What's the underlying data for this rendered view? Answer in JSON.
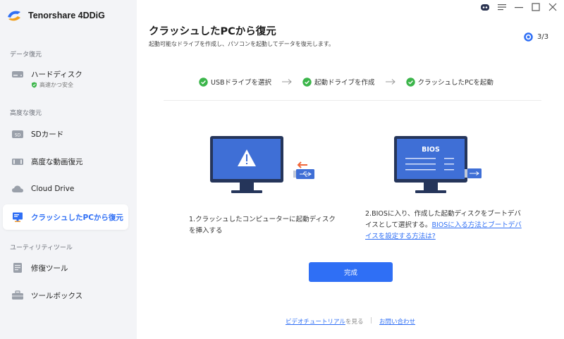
{
  "app": {
    "name": "Tenorshare 4DDiG"
  },
  "sidebar": {
    "sections": [
      {
        "label": "データ復元"
      },
      {
        "label": "高度な復元"
      },
      {
        "label": "ユーティリティツール"
      }
    ],
    "items": [
      {
        "label": "ハードディスク",
        "badge": "高速かつ安全",
        "icon": "hard-disk-icon"
      },
      {
        "label": "SDカード",
        "icon": "sd-card-icon"
      },
      {
        "label": "高度な動画復元",
        "icon": "video-icon"
      },
      {
        "label": "Cloud Drive",
        "icon": "cloud-icon"
      },
      {
        "label": "クラッシュしたPCから復元",
        "icon": "crashed-pc-icon",
        "active": true
      },
      {
        "label": "修復ツール",
        "icon": "repair-icon"
      },
      {
        "label": "ツールボックス",
        "icon": "toolbox-icon"
      }
    ]
  },
  "page": {
    "title": "クラッシュしたPCから復元",
    "subtitle": "起動可能なドライブを作成し、パソコンを起動してデータを復元します。",
    "step_count": "3/3"
  },
  "steps": [
    {
      "label": "USBドライブを選択"
    },
    {
      "label": "起動ドライブを作成"
    },
    {
      "label": "クラッシュしたPCを起動"
    }
  ],
  "illustration_left": {
    "caption": "1.クラッシュしたコンピューターに起動ディスクを挿入する"
  },
  "illustration_right": {
    "screen_label": "BIOS",
    "caption_prefix": "2.BIOSに入り、作成した起動ディスクをブートデバイスとして選択する。",
    "caption_link": "BIOSに入る方法とブートデバイスを設定する方法は?"
  },
  "done_label": "完成",
  "footer": {
    "video_link": "ビデオチュートリアル",
    "video_suffix": "を見る",
    "separator": "|",
    "contact_link": "お問い合わせ"
  },
  "colors": {
    "accent": "#2f6ff5",
    "success": "#3bb54a",
    "monitor": "#3f6fd6",
    "monitor_dark": "#25355a"
  }
}
